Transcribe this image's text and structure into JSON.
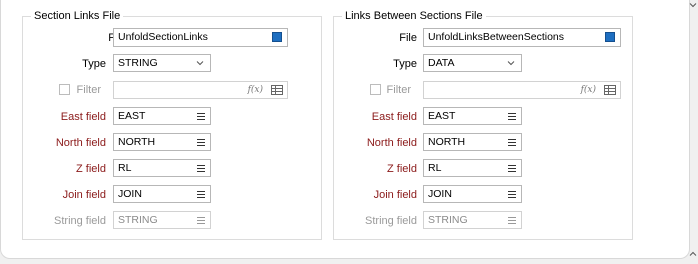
{
  "left": {
    "title": "Section Links File",
    "file_label": "File",
    "file_value": "UnfoldSectionLinks",
    "type_label": "Type",
    "type_value": "STRING",
    "filter_label": "Filter",
    "fx": "f(x)",
    "east_label": "East field",
    "east_value": "EAST",
    "north_label": "North field",
    "north_value": "NORTH",
    "z_label": "Z field",
    "z_value": "RL",
    "join_label": "Join field",
    "join_value": "JOIN",
    "string_label": "String field",
    "string_value": "STRING"
  },
  "right": {
    "title": "Links Between Sections File",
    "file_label": "File",
    "file_value": "UnfoldLinksBetweenSections",
    "type_label": "Type",
    "type_value": "DATA",
    "filter_label": "Filter",
    "fx": "f(x)",
    "east_label": "East field",
    "east_value": "EAST",
    "north_label": "North field",
    "north_value": "NORTH",
    "z_label": "Z field",
    "z_value": "RL",
    "join_label": "Join field",
    "join_value": "JOIN",
    "string_label": "String field",
    "string_value": "STRING"
  },
  "colors": {
    "file_swatch": "#1e6fc1",
    "field_label_red": "#8b1a1a",
    "disabled_text": "#9a9a9a"
  }
}
